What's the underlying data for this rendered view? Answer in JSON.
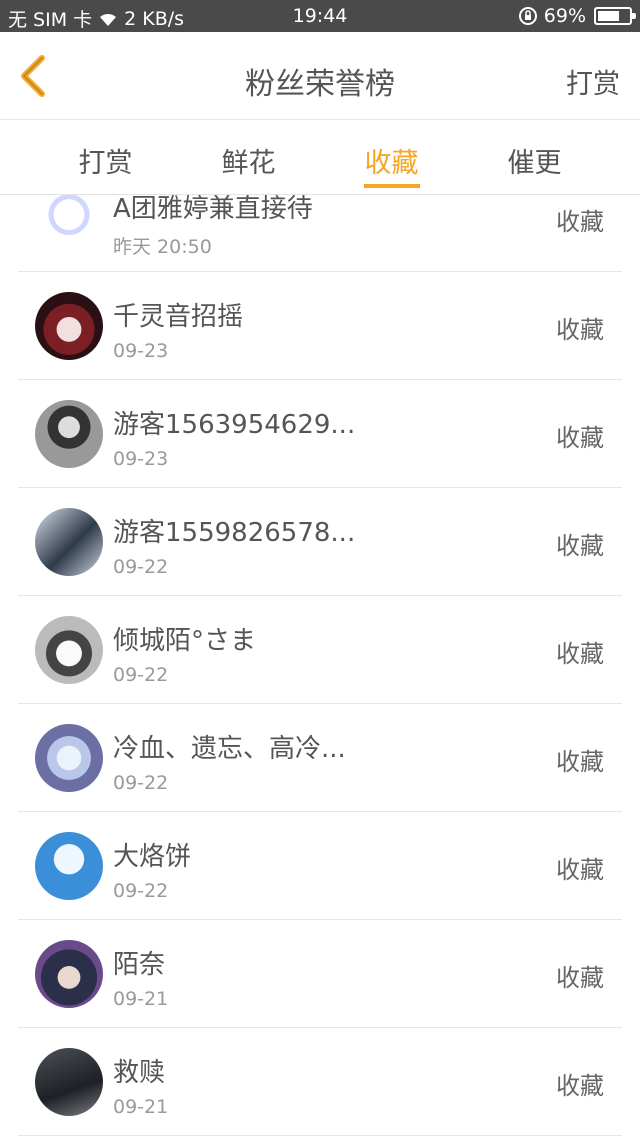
{
  "status_bar": {
    "carrier": "无 SIM 卡",
    "speed": "2 KB/s",
    "time": "19:44",
    "battery_percent": "69%",
    "battery_level": 0.69
  },
  "header": {
    "title": "粉丝荣誉榜",
    "action_label": "打赏",
    "back_icon": "back-chevron-icon",
    "accent_color": "#f5a623"
  },
  "tabs": [
    {
      "label": "打赏",
      "active": false
    },
    {
      "label": "鲜花",
      "active": false
    },
    {
      "label": "收藏",
      "active": true
    },
    {
      "label": "催更",
      "active": false
    }
  ],
  "list": [
    {
      "name": "A团雅婷兼直接待",
      "date": "昨天 20:50",
      "action": "收藏"
    },
    {
      "name": "千灵音招摇",
      "date": "09-23",
      "action": "收藏"
    },
    {
      "name": "游客1563954629...",
      "date": "09-23",
      "action": "收藏"
    },
    {
      "name": "游客1559826578...",
      "date": "09-22",
      "action": "收藏"
    },
    {
      "name": "倾城陌°さま",
      "date": "09-22",
      "action": "收藏"
    },
    {
      "name": "冷血、遗忘、高冷...",
      "date": "09-22",
      "action": "收藏"
    },
    {
      "name": "大烙饼",
      "date": "09-22",
      "action": "收藏"
    },
    {
      "name": "陌奈",
      "date": "09-21",
      "action": "收藏"
    },
    {
      "name": "救赎",
      "date": "09-21",
      "action": "收藏"
    }
  ]
}
